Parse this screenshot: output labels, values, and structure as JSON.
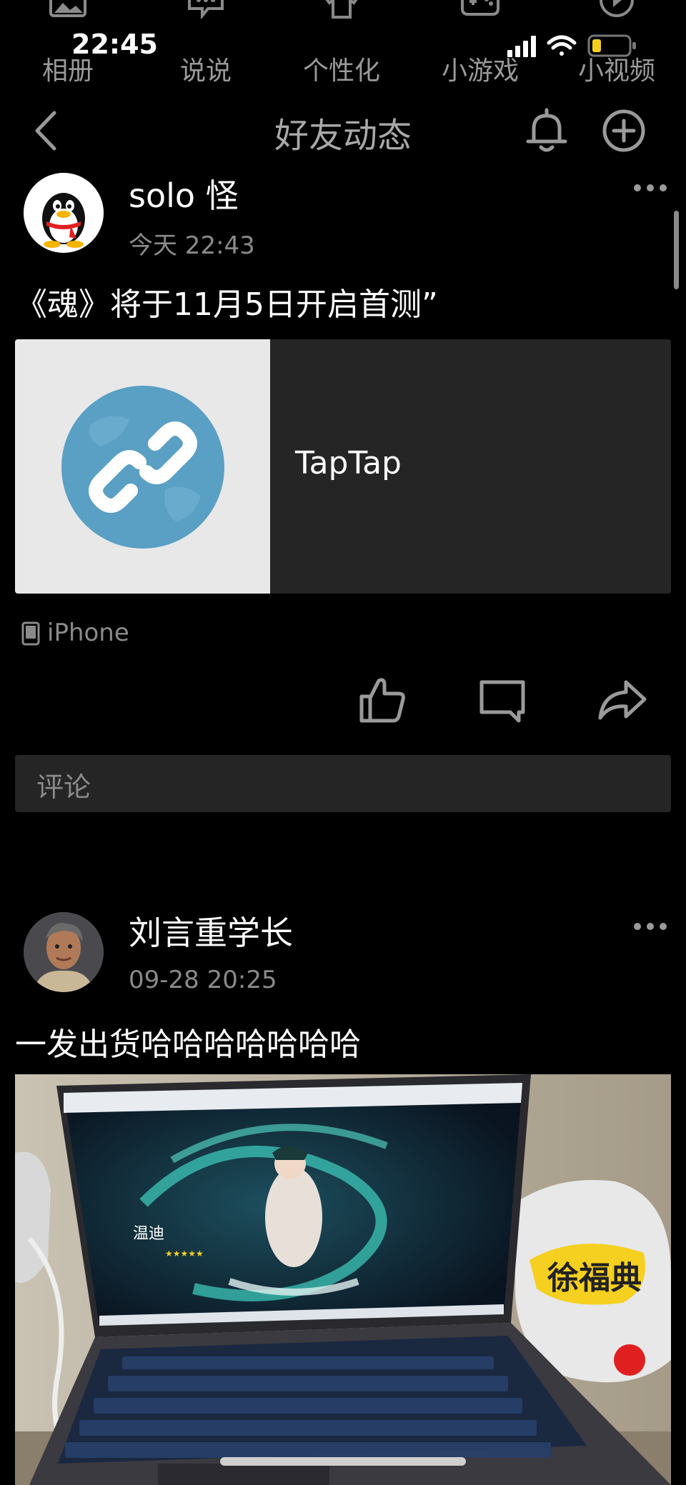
{
  "status": {
    "time": "22:45"
  },
  "categories": [
    {
      "label": "相册",
      "icon": "photo-icon"
    },
    {
      "label": "说说",
      "icon": "chat-bubble-icon"
    },
    {
      "label": "个性化",
      "icon": "shirt-icon"
    },
    {
      "label": "小游戏",
      "icon": "gamepad-icon"
    },
    {
      "label": "小视频",
      "icon": "play-icon"
    }
  ],
  "nav": {
    "title": "好友动态"
  },
  "posts": [
    {
      "author": "solo 怪",
      "time": "今天 22:43",
      "text": "《魂》将于11月5日开启首测”",
      "link_title": "TapTap",
      "device": "iPhone"
    },
    {
      "author": "刘言重学长",
      "time": "09-28 20:25",
      "text": "一发出货哈哈哈哈哈哈哈"
    }
  ],
  "comment": {
    "placeholder": "评论"
  },
  "photo": {
    "character_name": "温迪",
    "bag_text": "徐福典"
  },
  "colors": {
    "background": "#000000",
    "card": "#252525",
    "muted": "#8a8a8a",
    "link_globe": "#5a9fc4"
  }
}
